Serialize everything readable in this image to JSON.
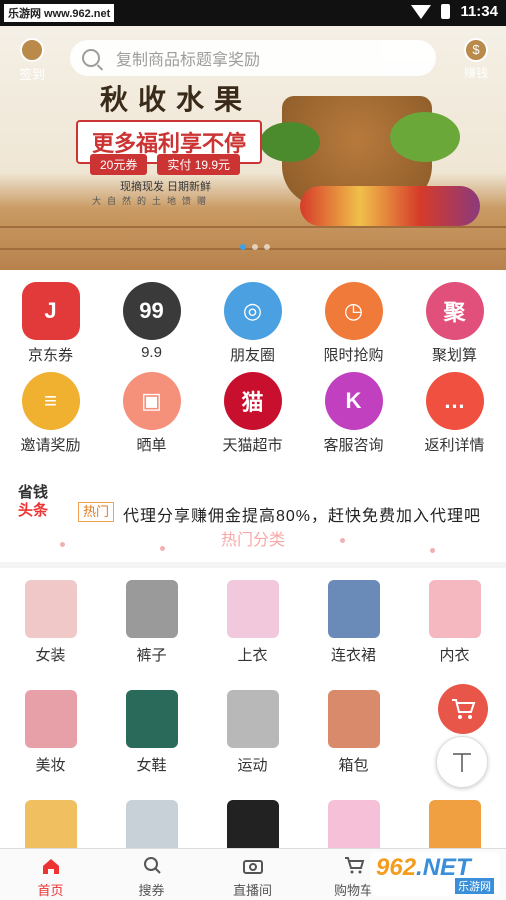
{
  "status_bar": {
    "watermark": "乐游网 www.962.net",
    "time": "11:34"
  },
  "header": {
    "signin_label": "签到",
    "search_placeholder": "复制商品标题拿奖励",
    "money_label": "赚钱",
    "money_icon_text": "$"
  },
  "banner": {
    "title": "秋收水果",
    "slogan": "更多福利享不停",
    "chip1": "20元券",
    "chip2": "实付 19.9元",
    "sub": "现摘现发 日期新鲜",
    "note": "大自然的土地馈赠",
    "active_slide": 1,
    "slide_count": 3
  },
  "quick_grid": [
    {
      "label": "京东券",
      "icon": "jd-coupon-icon",
      "color": "#e23a3a",
      "glyph": "J"
    },
    {
      "label": "9.9",
      "icon": "nine-nine-icon",
      "color": "#3a3a3a",
      "glyph": "99"
    },
    {
      "label": "朋友圈",
      "icon": "moments-icon",
      "color": "#4aa0e0",
      "glyph": "◎"
    },
    {
      "label": "限时抢购",
      "icon": "flash-sale-clock-icon",
      "color": "#f07a3a",
      "glyph": "◷"
    },
    {
      "label": "聚划算",
      "icon": "juhuasuan-icon",
      "color": "#e0507a",
      "glyph": "聚"
    },
    {
      "label": "邀请奖励",
      "icon": "coins-icon",
      "color": "#f0b030",
      "glyph": "≡"
    },
    {
      "label": "晒单",
      "icon": "gift-icon",
      "color": "#f5907a",
      "glyph": "▣"
    },
    {
      "label": "天猫超市",
      "icon": "tmall-icon",
      "color": "#c8102e",
      "glyph": "猫"
    },
    {
      "label": "客服咨询",
      "icon": "service-icon",
      "color": "#c040c0",
      "glyph": "K"
    },
    {
      "label": "返利详情",
      "icon": "chat-bubble-icon",
      "color": "#f05040",
      "glyph": "…"
    }
  ],
  "headline": {
    "logo_line1": "省钱",
    "logo_line2": "头条",
    "tag": "热门",
    "text": "代理分享赚佣金提高80%，赶快免费加入代理吧"
  },
  "hot_category_title": "热门分类",
  "categories": [
    {
      "label": "女装",
      "color": "#f0c8c8"
    },
    {
      "label": "裤子",
      "color": "#9a9a9a"
    },
    {
      "label": "上衣",
      "color": "#f2c8dc"
    },
    {
      "label": "连衣裙",
      "color": "#6a8ab8"
    },
    {
      "label": "内衣",
      "color": "#f5b8c0"
    },
    {
      "label": "美妆",
      "color": "#e8a0a8"
    },
    {
      "label": "女鞋",
      "color": "#2a6a5a"
    },
    {
      "label": "运动",
      "color": "#b8b8b8"
    },
    {
      "label": "箱包",
      "color": "#d88a6a"
    },
    {
      "label": "",
      "color": "#ffffff"
    },
    {
      "label": "",
      "color": "#f0c060"
    },
    {
      "label": "",
      "color": "#c8d0d8"
    },
    {
      "label": "",
      "color": "#222222"
    },
    {
      "label": "",
      "color": "#f5c0d8"
    },
    {
      "label": "",
      "color": "#f0a040"
    }
  ],
  "tabbar": [
    {
      "label": "首页",
      "icon": "home-icon",
      "active": true
    },
    {
      "label": "搜券",
      "icon": "search-icon",
      "active": false
    },
    {
      "label": "直播间",
      "icon": "camera-icon",
      "active": false
    },
    {
      "label": "购物车",
      "icon": "cart-icon",
      "active": false
    }
  ],
  "site_watermark": {
    "brand": "962",
    "suffix": ".NET",
    "sub": "乐游网"
  }
}
